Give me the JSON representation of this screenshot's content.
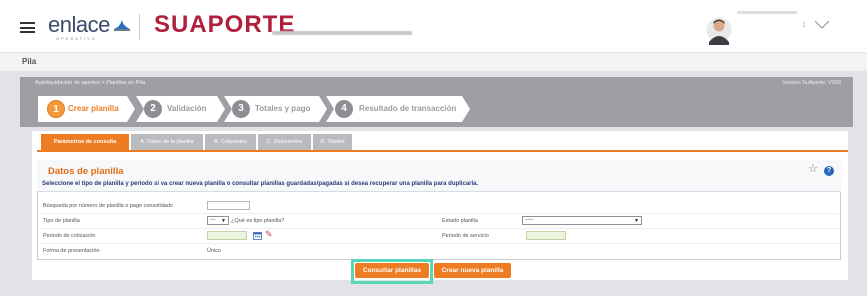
{
  "header": {
    "brand_enlace": "enlace",
    "brand_enlace_sub": "OPERATIVO",
    "brand_suaporte": "SUAPORTE",
    "user_number": "1",
    "icons": [
      "menu-icon",
      "avatar-icon",
      "chevron-down-icon"
    ]
  },
  "section": {
    "title": "Pila"
  },
  "breadcrumb": {
    "path": "Autoliquidación de aportes  >  Planillas en Pila",
    "version": "Versión SuAporte: V268"
  },
  "steps": [
    {
      "number": "1",
      "label": "Crear planilla",
      "state": "active"
    },
    {
      "number": "2",
      "label": "Validación",
      "state": "pending"
    },
    {
      "number": "3",
      "label": "Totales y pago",
      "state": "pending"
    },
    {
      "number": "4",
      "label": "Resultado de transacción",
      "state": "pending"
    }
  ],
  "tabs": [
    {
      "label": "Parámetros de consulta",
      "active": true
    },
    {
      "label": "A. Datos de la planilla",
      "active": false
    },
    {
      "label": "B. Cotizantes",
      "active": false
    },
    {
      "label": "C. Descuentos",
      "active": false
    },
    {
      "label": "D. Totales",
      "active": false
    }
  ],
  "datos": {
    "title": "Datos de planilla",
    "description": "Seleccione el tipo de planilla y periodo si va crear nueva planilla o consultar planillas guardadas/pagadas si desea recuperar una planilla para duplicarla.",
    "fields": {
      "busqueda_label": "Búsqueda por número de planilla o pago consolidado",
      "busqueda_value": "",
      "tipo_label": "Tipo de planilla",
      "tipo_value": "---",
      "tipo_help": "¿Qué es tipo planilla?",
      "estado_label": "Estado planilla",
      "estado_value": "-----",
      "cotizacion_label": "Periodo de cotización",
      "servicio_label": "Periodo de servicio",
      "forma_label": "Forma de presentación",
      "forma_value": "Único"
    }
  },
  "buttons": {
    "consultar": "Consultar planillas",
    "crear": "Crear nueva planilla"
  },
  "colors": {
    "accent": "#ee7c22",
    "brand_red": "#b0203c",
    "brand_blue": "#3b4a6b",
    "title_orange": "#e46c12",
    "highlight": "#58d6b8"
  }
}
